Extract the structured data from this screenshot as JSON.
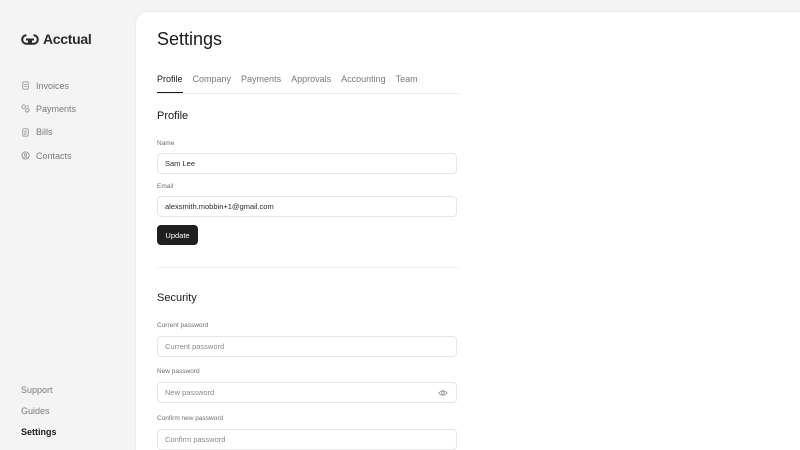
{
  "app": {
    "name": "Acctual"
  },
  "sidebar": {
    "items": [
      {
        "label": "Invoices",
        "icon": "document-icon"
      },
      {
        "label": "Payments",
        "icon": "payments-icon"
      },
      {
        "label": "Bills",
        "icon": "bill-icon"
      },
      {
        "label": "Contacts",
        "icon": "contacts-icon"
      }
    ],
    "bottom": [
      {
        "label": "Support"
      },
      {
        "label": "Guides"
      },
      {
        "label": "Settings",
        "active": true
      }
    ]
  },
  "page": {
    "title": "Settings"
  },
  "tabs": [
    {
      "label": "Profile",
      "active": true
    },
    {
      "label": "Company"
    },
    {
      "label": "Payments"
    },
    {
      "label": "Approvals"
    },
    {
      "label": "Accounting"
    },
    {
      "label": "Team"
    }
  ],
  "profile": {
    "title": "Profile",
    "name_label": "Name",
    "name_value": "Sam Lee",
    "email_label": "Email",
    "email_value": "alexsmith.mobbin+1@gmail.com",
    "update_label": "Update"
  },
  "security": {
    "title": "Security",
    "current_label": "Current password",
    "current_placeholder": "Current password",
    "new_label": "New password",
    "new_placeholder": "New password",
    "confirm_label": "Confirm new password",
    "confirm_placeholder": "Confirm password"
  },
  "colors": {
    "background": "#f4f4f4",
    "card": "#ffffff",
    "primary_button": "#1f1f1f"
  }
}
